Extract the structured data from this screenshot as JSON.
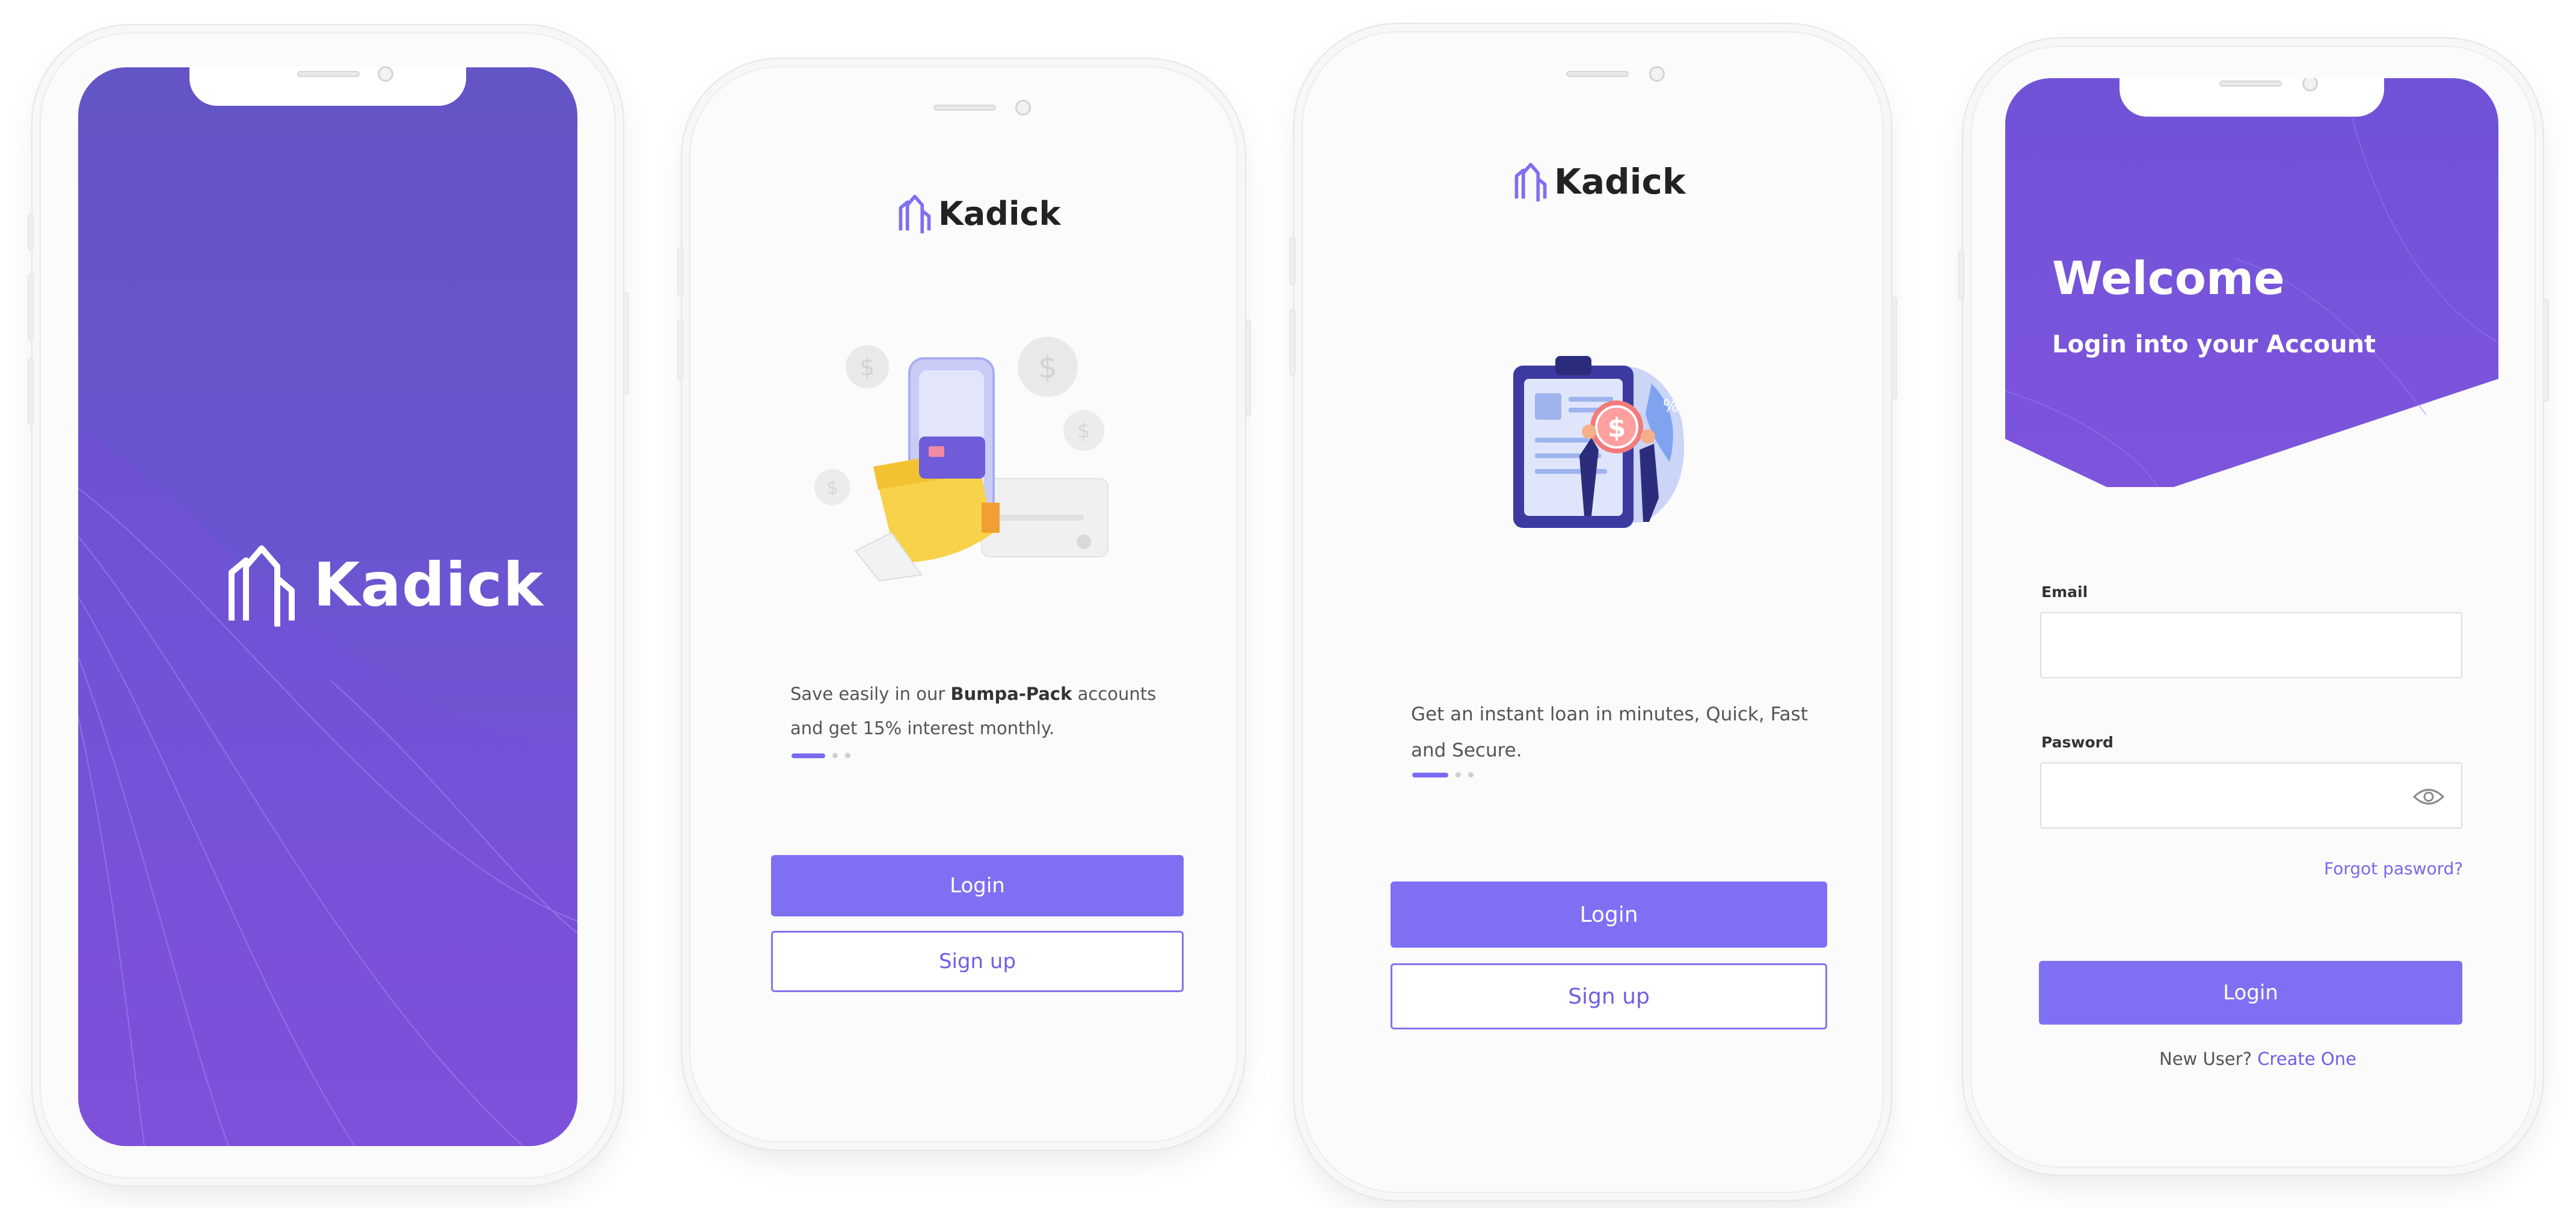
{
  "brand": {
    "name": "Kadick",
    "accent": "#7f6ff2",
    "gradient_top": "#6455c6",
    "gradient_bottom": "#8a52dc"
  },
  "splash": {
    "logo_icon": "kadick-logo-icon"
  },
  "onboarding_1": {
    "illustration": "wallet-phone-card-coins-illustration",
    "caption_pre": "Save easily in our ",
    "caption_bold": "Bumpa-Pack",
    "caption_post": " accounts and get 15% interest monthly.",
    "login_label": "Login",
    "signup_label": "Sign up",
    "page_index": 1,
    "page_count": 3
  },
  "onboarding_2": {
    "illustration": "loan-clipboard-dollar-illustration",
    "caption": "Get an instant loan in minutes, Quick, Fast and Secure.",
    "login_label": "Login",
    "signup_label": "Sign up",
    "page_index": 1,
    "page_count": 3
  },
  "login": {
    "title": "Welcome",
    "subtitle": "Login into your Account",
    "email_label": "Email",
    "email_value": "",
    "password_label": "Pasword",
    "password_value": "",
    "password_toggle_icon": "eye-icon",
    "forgot_label": "Forgot pasword?",
    "login_label": "Login",
    "new_user_label": "New User?",
    "create_label": "Create One"
  }
}
